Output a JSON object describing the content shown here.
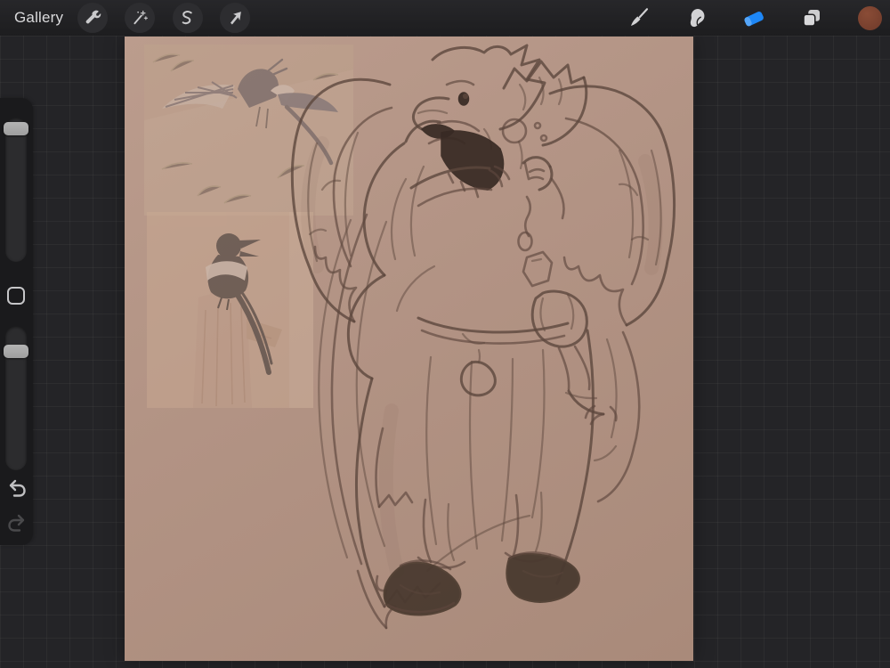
{
  "toolbar": {
    "gallery_label": "Gallery",
    "left_tools": [
      {
        "id": "actions",
        "icon": "wrench-icon",
        "title": "Actions"
      },
      {
        "id": "adjustments",
        "icon": "magic-wand-icon",
        "title": "Adjustments"
      },
      {
        "id": "selection",
        "icon": "selection-s-icon",
        "title": "Selection"
      },
      {
        "id": "transform",
        "icon": "transform-arrow-icon",
        "title": "Transform"
      }
    ],
    "right_tools": [
      {
        "id": "paint",
        "icon": "paintbrush-icon",
        "title": "Paint",
        "active": false
      },
      {
        "id": "smudge",
        "icon": "smudge-finger-icon",
        "title": "Smudge",
        "active": false
      },
      {
        "id": "erase",
        "icon": "eraser-icon",
        "title": "Erase",
        "active": true,
        "accent_color": "#1e87f6"
      },
      {
        "id": "layers",
        "icon": "layers-icon",
        "title": "Layers",
        "active": false
      },
      {
        "id": "color",
        "icon": "color-swatch",
        "title": "Color",
        "swatch_color": "#7b4230"
      }
    ]
  },
  "sidebar": {
    "brush_size_slider": {
      "title": "Brush size"
    },
    "modify_button": {
      "title": "Modify"
    },
    "opacity_slider": {
      "title": "Opacity"
    },
    "undo": {
      "title": "Undo",
      "enabled": true
    },
    "redo": {
      "title": "Redo",
      "enabled": false
    }
  },
  "canvas": {
    "background_color": "#b29384",
    "sketch_line_color": "#5d473d",
    "artwork_description": "Pencil sketch of a winged magpie-headed figure in a long robe holding a monocled person, with chain and pendants, dark boots",
    "references": [
      {
        "name": "flying-magpie-photo"
      },
      {
        "name": "perched-magpie-photo"
      }
    ]
  },
  "colors": {
    "toolbar_bg": "#1f1f21",
    "workspace_bg": "#242427",
    "sidebar_bg": "#1a1a1c",
    "accent_blue": "#1e87f6",
    "swatch_brown": "#7b4230"
  }
}
